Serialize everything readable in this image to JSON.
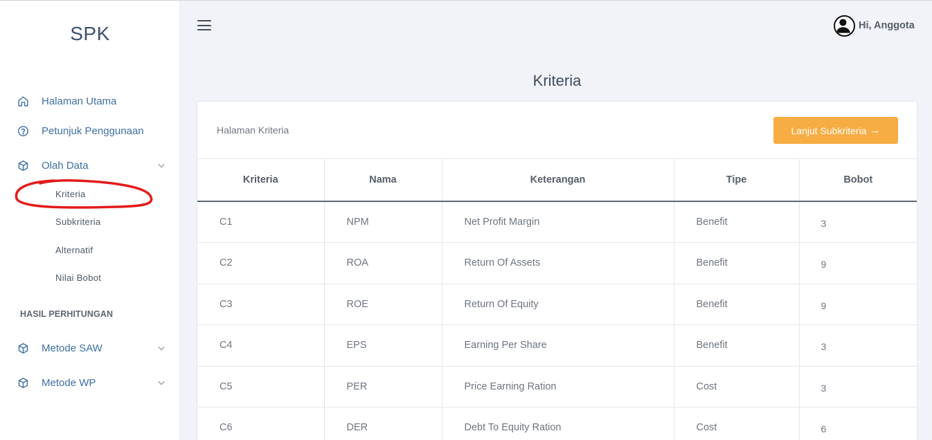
{
  "sidebar": {
    "brand": "SPK",
    "items": [
      {
        "label": "Halaman Utama"
      },
      {
        "label": "Petunjuk Penggunaan"
      },
      {
        "label": "Olah Data"
      }
    ],
    "olah_data_sub": [
      "Kriteria",
      "Subkriteria",
      "Alternatif",
      "Nilai Bobot"
    ],
    "section_hasil": "HASIL PERHITUNGAN",
    "hasil_items": [
      {
        "label": "Metode SAW"
      },
      {
        "label": "Metode WP"
      }
    ],
    "annotation_color": "#e31b1b"
  },
  "topbar": {
    "user_greeting": "Hi, Anggota"
  },
  "main": {
    "title": "Kriteria",
    "card_label": "Halaman Kriteria",
    "next_button": "Lanjut Subkriteria",
    "accent": "#f7ad43",
    "columns": [
      "Kriteria",
      "Nama",
      "Keterangan",
      "Tipe",
      "Bobot"
    ],
    "rows": [
      [
        "C1",
        "NPM",
        "Net Profit Margin",
        "Benefit",
        "3"
      ],
      [
        "C2",
        "ROA",
        "Return Of Assets",
        "Benefit",
        "9"
      ],
      [
        "C3",
        "ROE",
        "Return Of Equity",
        "Benefit",
        "9"
      ],
      [
        "C4",
        "EPS",
        "Earning Per Share",
        "Benefit",
        "3"
      ],
      [
        "C5",
        "PER",
        "Price Earning Ration",
        "Cost",
        "3"
      ],
      [
        "C6",
        "DER",
        "Debt To Equity Ration",
        "Cost",
        "6"
      ]
    ]
  }
}
